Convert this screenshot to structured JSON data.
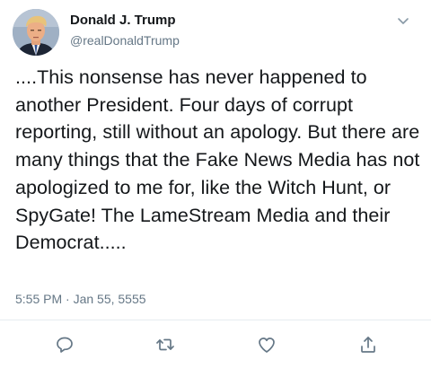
{
  "tweet": {
    "author_name": "Donald J. Trump",
    "author_handle": "@realDonaldTrump",
    "body": "....This nonsense has never happened to another President. Four days of corrupt reporting, still without an apology. But there are many things that the Fake News Media has not apologized to me for, like the Witch Hunt, or SpyGate! The LameStream Media and their Democrat.....",
    "timestamp": "5:55 PM · Jan 55, 5555"
  },
  "icons": {
    "menu": "chevron-down-icon",
    "reply": "reply-icon",
    "retweet": "retweet-icon",
    "like": "heart-icon",
    "share": "share-icon"
  },
  "colors": {
    "text": "#14171a",
    "secondary": "#657786",
    "divider": "#e6ecf0"
  }
}
